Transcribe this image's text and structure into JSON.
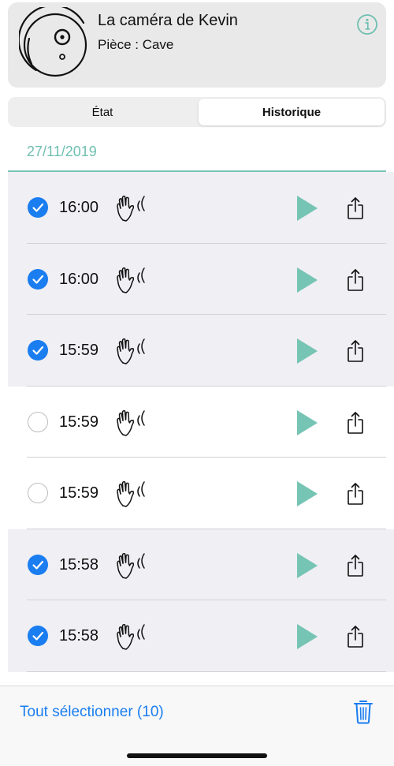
{
  "header": {
    "camera_name": "La caméra de Kevin",
    "room": "Pièce : Cave",
    "camera_icon": "robot-camera-icon",
    "info_icon": "info-icon"
  },
  "tabs": [
    {
      "label": "État",
      "active": false
    },
    {
      "label": "Historique",
      "active": true
    }
  ],
  "history": {
    "date": "27/11/2019",
    "events": [
      {
        "time": "16:00",
        "selected": true,
        "event_icon": "motion-hand-wave-icon"
      },
      {
        "time": "16:00",
        "selected": true,
        "event_icon": "motion-hand-wave-icon"
      },
      {
        "time": "15:59",
        "selected": true,
        "event_icon": "motion-hand-wave-icon"
      },
      {
        "time": "15:59",
        "selected": false,
        "event_icon": "motion-hand-wave-icon"
      },
      {
        "time": "15:59",
        "selected": false,
        "event_icon": "motion-hand-wave-icon"
      },
      {
        "time": "15:58",
        "selected": true,
        "event_icon": "motion-hand-wave-icon"
      },
      {
        "time": "15:58",
        "selected": true,
        "event_icon": "motion-hand-wave-icon"
      }
    ]
  },
  "toolbar": {
    "select_all_label": "Tout sélectionner (10)",
    "trash_icon": "trash-icon"
  },
  "colors": {
    "accent_teal": "#6fbfb0",
    "play_teal": "#76c4b4",
    "ios_blue": "#1a7df0",
    "selected_row_bg": "#efeff4"
  }
}
